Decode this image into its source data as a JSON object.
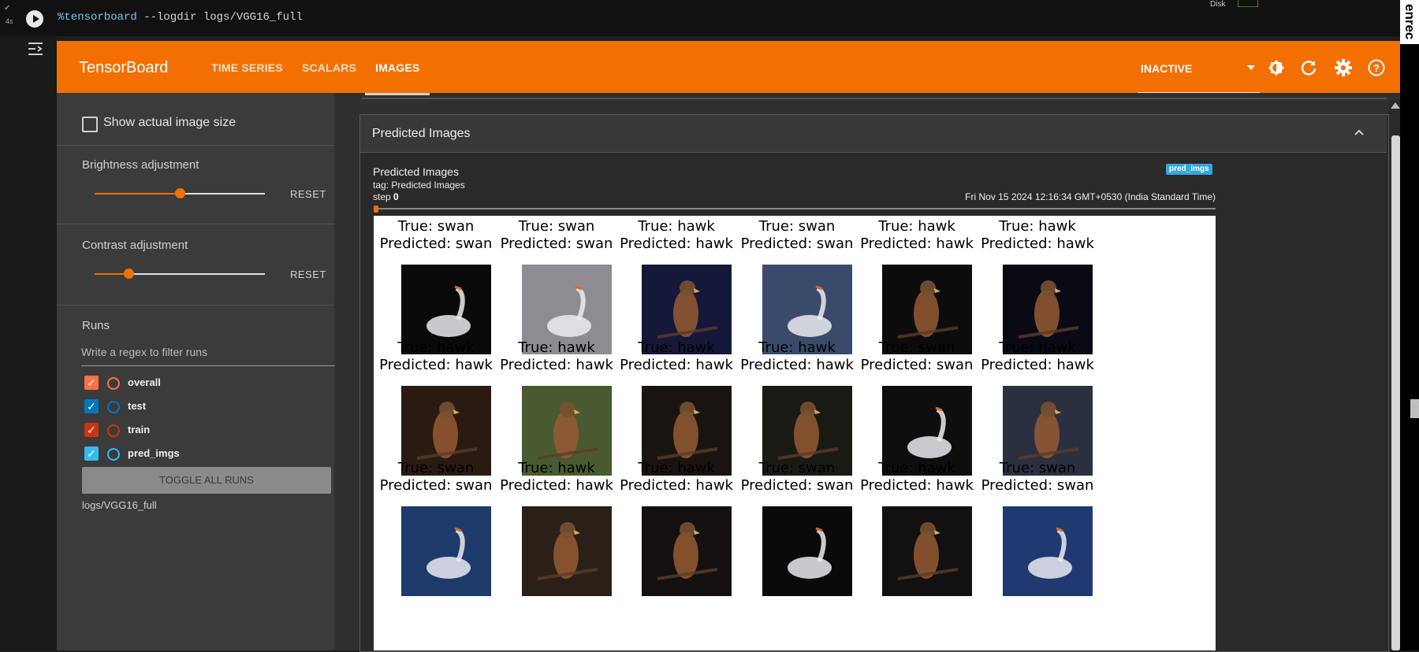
{
  "cell": {
    "command_magic": "%tensorboard",
    "command_args": " --logdir logs/VGG16_full",
    "exec_time": "4s",
    "disk_label": "Disk",
    "edge_label": "enrec"
  },
  "header": {
    "logo": "TensorBoard",
    "tabs": [
      "TIME SERIES",
      "SCALARS",
      "IMAGES"
    ],
    "active_tab": "IMAGES",
    "status": "INACTIVE",
    "icons": [
      "brightness-contrast-icon",
      "refresh-icon",
      "settings-icon",
      "help-icon"
    ],
    "accent_color": "#f37000"
  },
  "sidebar": {
    "show_actual_size": "Show actual image size",
    "brightness_label": "Brightness adjustment",
    "contrast_label": "Contrast adjustment",
    "reset_label": "RESET",
    "brightness_value": 0.5,
    "contrast_value": 0.2,
    "runs_label": "Runs",
    "runs_filter_placeholder": "Write a regex to filter runs",
    "runs": [
      {
        "name": "overall",
        "checked": true,
        "color": "#ff7043"
      },
      {
        "name": "test",
        "checked": true,
        "color": "#0077bb"
      },
      {
        "name": "train",
        "checked": true,
        "color": "#cc3311"
      },
      {
        "name": "pred_imgs",
        "checked": true,
        "color": "#33bbee"
      }
    ],
    "toggle_all": "TOGGLE ALL RUNS",
    "logdir": "logs/VGG16_full"
  },
  "card": {
    "title": "Predicted Images",
    "image_title": "Predicted Images",
    "tag": "tag: Predicted Images",
    "step_label": "step",
    "step_value": "0",
    "run_chip": "pred_imgs",
    "timestamp": "Fri Nov 15 2024 12:16:34 GMT+0530 (India Standard Time)",
    "grid": [
      {
        "true_label": "True: swan",
        "pred_label": "Predicted: swan",
        "subject": "swan"
      },
      {
        "true_label": "True: swan",
        "pred_label": "Predicted: swan",
        "subject": "swan"
      },
      {
        "true_label": "True: hawk",
        "pred_label": "Predicted: hawk",
        "subject": "hawk"
      },
      {
        "true_label": "True: swan",
        "pred_label": "Predicted: swan",
        "subject": "swan"
      },
      {
        "true_label": "True: hawk",
        "pred_label": "Predicted: hawk",
        "subject": "hawk"
      },
      {
        "true_label": "True: hawk",
        "pred_label": "Predicted: hawk",
        "subject": "hawk"
      },
      {
        "true_label": "True: hawk",
        "pred_label": "Predicted: hawk",
        "subject": "hawk"
      },
      {
        "true_label": "True: hawk",
        "pred_label": "Predicted: hawk",
        "subject": "hawk"
      },
      {
        "true_label": "True: hawk",
        "pred_label": "Predicted: hawk",
        "subject": "hawk"
      },
      {
        "true_label": "True: hawk",
        "pred_label": "Predicted: hawk",
        "subject": "hawk"
      },
      {
        "true_label": "True: swan",
        "pred_label": "Predicted: swan",
        "subject": "swan"
      },
      {
        "true_label": "True: hawk",
        "pred_label": "Predicted: hawk",
        "subject": "hawk"
      },
      {
        "true_label": "True: swan",
        "pred_label": "Predicted: swan",
        "subject": "swan"
      },
      {
        "true_label": "True: hawk",
        "pred_label": "Predicted: hawk",
        "subject": "hawk"
      },
      {
        "true_label": "True: hawk",
        "pred_label": "Predicted: hawk",
        "subject": "hawk"
      },
      {
        "true_label": "True: swan",
        "pred_label": "Predicted: swan",
        "subject": "swan"
      },
      {
        "true_label": "True: hawk",
        "pred_label": "Predicted: hawk",
        "subject": "hawk"
      },
      {
        "true_label": "True: swan",
        "pred_label": "Predicted: swan",
        "subject": "swan"
      }
    ],
    "thumb_colors": [
      "#0a0a0a",
      "#8e8b92",
      "#151838",
      "#3a4a6a",
      "#0c0c0c",
      "#0a0a14",
      "#2a1a12",
      "#4a5a30",
      "#1a1410",
      "#1a1a14",
      "#0e0e0e",
      "#2a3040",
      "#1e3a6a",
      "#2a2018",
      "#141010",
      "#0a0a0a",
      "#121010",
      "#203a70"
    ]
  }
}
